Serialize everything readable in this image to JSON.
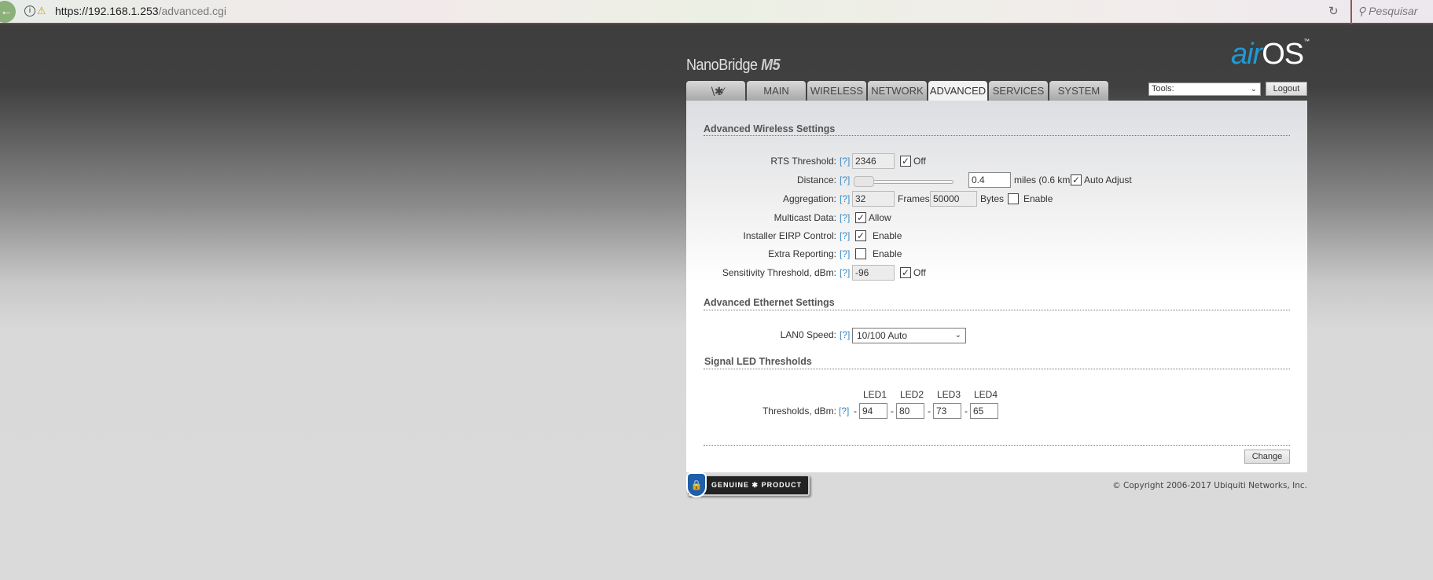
{
  "browser": {
    "url_host": "https://192.168.1.253",
    "url_path": "/advanced.cgi",
    "search_placeholder": "Pesquisar"
  },
  "header": {
    "product": "NanoBridge",
    "model": "M5",
    "logo_air": "air",
    "logo_os": "OS",
    "logo_tm": "™"
  },
  "tabs": [
    {
      "label": "",
      "icon": "ubnt-logo-icon"
    },
    {
      "label": "MAIN"
    },
    {
      "label": "WIRELESS"
    },
    {
      "label": "NETWORK"
    },
    {
      "label": "ADVANCED",
      "active": true
    },
    {
      "label": "SERVICES"
    },
    {
      "label": "SYSTEM"
    }
  ],
  "tools": {
    "selected": "Tools:",
    "logout": "Logout"
  },
  "help": "[?]",
  "wireless": {
    "title": "Advanced Wireless Settings",
    "rts": {
      "label": "RTS Threshold:",
      "value": "2346",
      "off_checked": true,
      "off_label": "Off"
    },
    "distance": {
      "label": "Distance:",
      "slider_fraction": 0.05,
      "value": "0.4",
      "unit": "miles (0.6 km)",
      "auto_checked": true,
      "auto_label": "Auto Adjust"
    },
    "aggregation": {
      "label": "Aggregation:",
      "frames": "32",
      "frames_label": "Frames",
      "bytes": "50000",
      "bytes_label": "Bytes",
      "enable_checked": false,
      "enable_label": "Enable"
    },
    "multicast": {
      "label": "Multicast Data:",
      "checked": true,
      "option": "Allow"
    },
    "eirp": {
      "label": "Installer EIRP Control:",
      "checked": true,
      "option": "Enable"
    },
    "extra": {
      "label": "Extra Reporting:",
      "checked": false,
      "option": "Enable"
    },
    "sensitivity": {
      "label": "Sensitivity Threshold, dBm:",
      "value": "-96",
      "off_checked": true,
      "off_label": "Off"
    }
  },
  "ethernet": {
    "title": "Advanced Ethernet Settings",
    "lan_label": "LAN0 Speed:",
    "lan_value": "10/100 Auto"
  },
  "led": {
    "title": "Signal LED Thresholds",
    "label": "Thresholds, dBm:",
    "sign": "-",
    "headers": [
      "LED1",
      "LED2",
      "LED3",
      "LED4"
    ],
    "values": [
      "94",
      "80",
      "73",
      "65"
    ]
  },
  "change_label": "Change",
  "footer": {
    "badge_left": "GENUINE",
    "badge_right": "PRODUCT",
    "copyright": "© Copyright 2006-2017 Ubiquiti Networks, Inc."
  }
}
